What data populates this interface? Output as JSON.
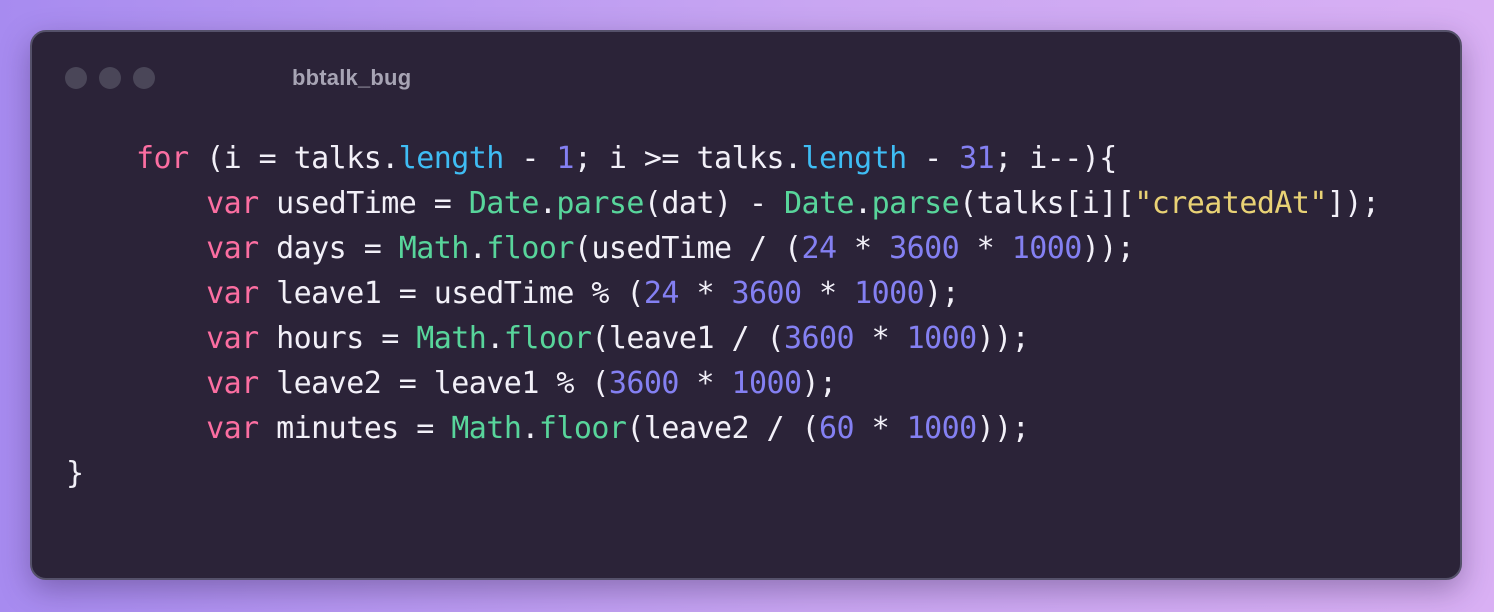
{
  "window": {
    "title": "bbtalk_bug"
  },
  "code": {
    "lines": [
      [
        {
          "t": "    "
        },
        {
          "t": "for",
          "c": "kw"
        },
        {
          "t": " (i = talks."
        },
        {
          "t": "length",
          "c": "prop"
        },
        {
          "t": " - "
        },
        {
          "t": "1",
          "c": "num"
        },
        {
          "t": "; i >= talks."
        },
        {
          "t": "length",
          "c": "prop"
        },
        {
          "t": " - "
        },
        {
          "t": "31",
          "c": "num"
        },
        {
          "t": "; i--){"
        }
      ],
      [
        {
          "t": "        "
        },
        {
          "t": "var",
          "c": "kw"
        },
        {
          "t": " usedTime = "
        },
        {
          "t": "Date",
          "c": "fn"
        },
        {
          "t": "."
        },
        {
          "t": "parse",
          "c": "fn"
        },
        {
          "t": "(dat) - "
        },
        {
          "t": "Date",
          "c": "fn"
        },
        {
          "t": "."
        },
        {
          "t": "parse",
          "c": "fn"
        },
        {
          "t": "(talks[i]["
        },
        {
          "t": "\"createdAt\"",
          "c": "str"
        },
        {
          "t": "]);"
        }
      ],
      [
        {
          "t": "        "
        },
        {
          "t": "var",
          "c": "kw"
        },
        {
          "t": " days = "
        },
        {
          "t": "Math",
          "c": "fn"
        },
        {
          "t": "."
        },
        {
          "t": "floor",
          "c": "fn"
        },
        {
          "t": "(usedTime / ("
        },
        {
          "t": "24",
          "c": "num"
        },
        {
          "t": " * "
        },
        {
          "t": "3600",
          "c": "num"
        },
        {
          "t": " * "
        },
        {
          "t": "1000",
          "c": "num"
        },
        {
          "t": "));"
        }
      ],
      [
        {
          "t": "        "
        },
        {
          "t": "var",
          "c": "kw"
        },
        {
          "t": " leave1 = usedTime % ("
        },
        {
          "t": "24",
          "c": "num"
        },
        {
          "t": " * "
        },
        {
          "t": "3600",
          "c": "num"
        },
        {
          "t": " * "
        },
        {
          "t": "1000",
          "c": "num"
        },
        {
          "t": ");"
        }
      ],
      [
        {
          "t": "        "
        },
        {
          "t": "var",
          "c": "kw"
        },
        {
          "t": " hours = "
        },
        {
          "t": "Math",
          "c": "fn"
        },
        {
          "t": "."
        },
        {
          "t": "floor",
          "c": "fn"
        },
        {
          "t": "(leave1 / ("
        },
        {
          "t": "3600",
          "c": "num"
        },
        {
          "t": " * "
        },
        {
          "t": "1000",
          "c": "num"
        },
        {
          "t": "));"
        }
      ],
      [
        {
          "t": "        "
        },
        {
          "t": "var",
          "c": "kw"
        },
        {
          "t": " leave2 = leave1 % ("
        },
        {
          "t": "3600",
          "c": "num"
        },
        {
          "t": " * "
        },
        {
          "t": "1000",
          "c": "num"
        },
        {
          "t": ");"
        }
      ],
      [
        {
          "t": "        "
        },
        {
          "t": "var",
          "c": "kw"
        },
        {
          "t": " minutes = "
        },
        {
          "t": "Math",
          "c": "fn"
        },
        {
          "t": "."
        },
        {
          "t": "floor",
          "c": "fn"
        },
        {
          "t": "(leave2 / ("
        },
        {
          "t": "60",
          "c": "num"
        },
        {
          "t": " * "
        },
        {
          "t": "1000",
          "c": "num"
        },
        {
          "t": "));"
        }
      ],
      [
        {
          "t": "}"
        }
      ]
    ]
  },
  "colors": {
    "keyword": "#fb6ea1",
    "property": "#3fbdf4",
    "function": "#58d59b",
    "number": "#8480f2",
    "string": "#e9d275",
    "text": "#f2f0f8",
    "window_bg": "#2b2338"
  }
}
